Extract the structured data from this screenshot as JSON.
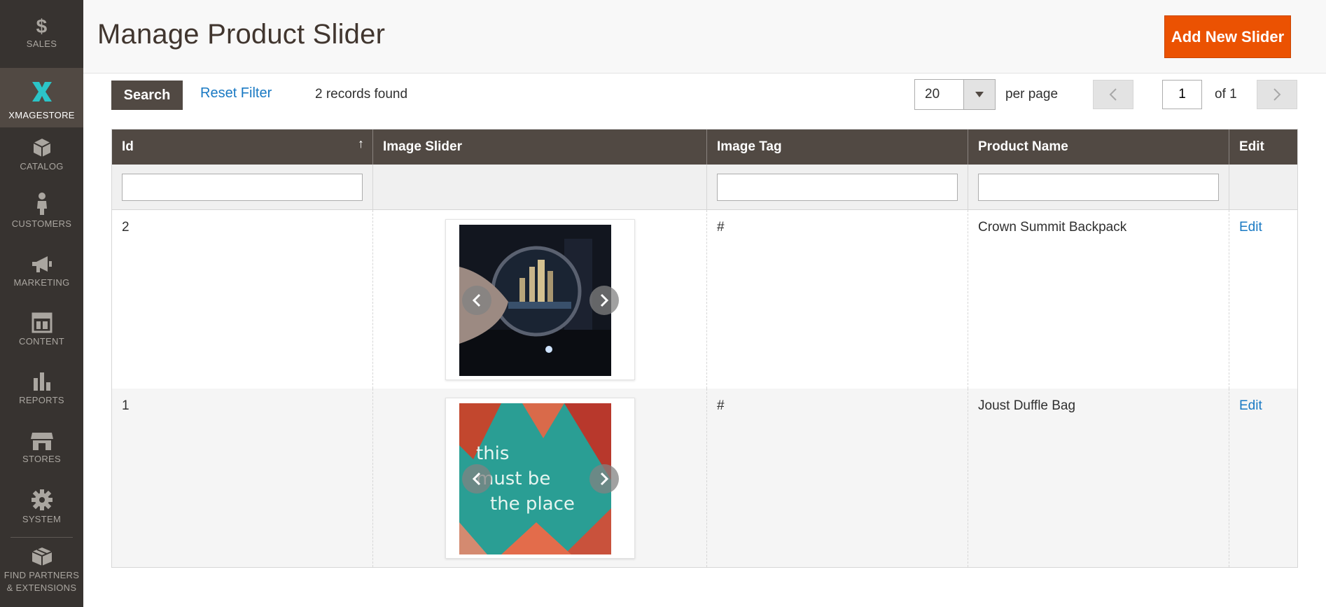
{
  "sidebar": {
    "items": [
      {
        "label": "Sales",
        "icon": "dollar-icon"
      },
      {
        "label": "XMAGESTORE",
        "icon": "xmagestore-logo-icon"
      },
      {
        "label": "Catalog",
        "icon": "cube-icon"
      },
      {
        "label": "Customers",
        "icon": "person-icon"
      },
      {
        "label": "Marketing",
        "icon": "megaphone-icon"
      },
      {
        "label": "Content",
        "icon": "layout-icon"
      },
      {
        "label": "Reports",
        "icon": "bar-chart-icon"
      },
      {
        "label": "Stores",
        "icon": "storefront-icon"
      },
      {
        "label": "System",
        "icon": "gear-icon"
      },
      {
        "label": "Find Partners",
        "label2": "& Extensions",
        "icon": "partners-box-icon"
      }
    ],
    "active_index": 1
  },
  "header": {
    "title": "Manage Product Slider",
    "add_button": "Add New Slider"
  },
  "toolbar": {
    "search_label": "Search",
    "reset_label": "Reset Filter",
    "records_found": "2 records found",
    "per_page_value": "20",
    "per_page_label": "per page",
    "current_page": "1",
    "total_pages_label": "of 1"
  },
  "grid": {
    "columns": [
      "Id",
      "Image Slider",
      "Image Tag",
      "Product Name",
      "Edit"
    ],
    "rows": [
      {
        "id": "2",
        "image_tag": "#",
        "product_name": "Crown Summit Backpack",
        "edit": "Edit",
        "image": "magnifying-glass-city-photo"
      },
      {
        "id": "1",
        "image_tag": "#",
        "product_name": "Joust Duffle Bag",
        "edit": "Edit",
        "image": "neon-sign-photo",
        "image_text": "this must be the place"
      }
    ]
  },
  "colors": {
    "accent": "#eb5202",
    "sidebar_bg": "#373330",
    "header_row": "#514943",
    "link": "#1979c3"
  }
}
